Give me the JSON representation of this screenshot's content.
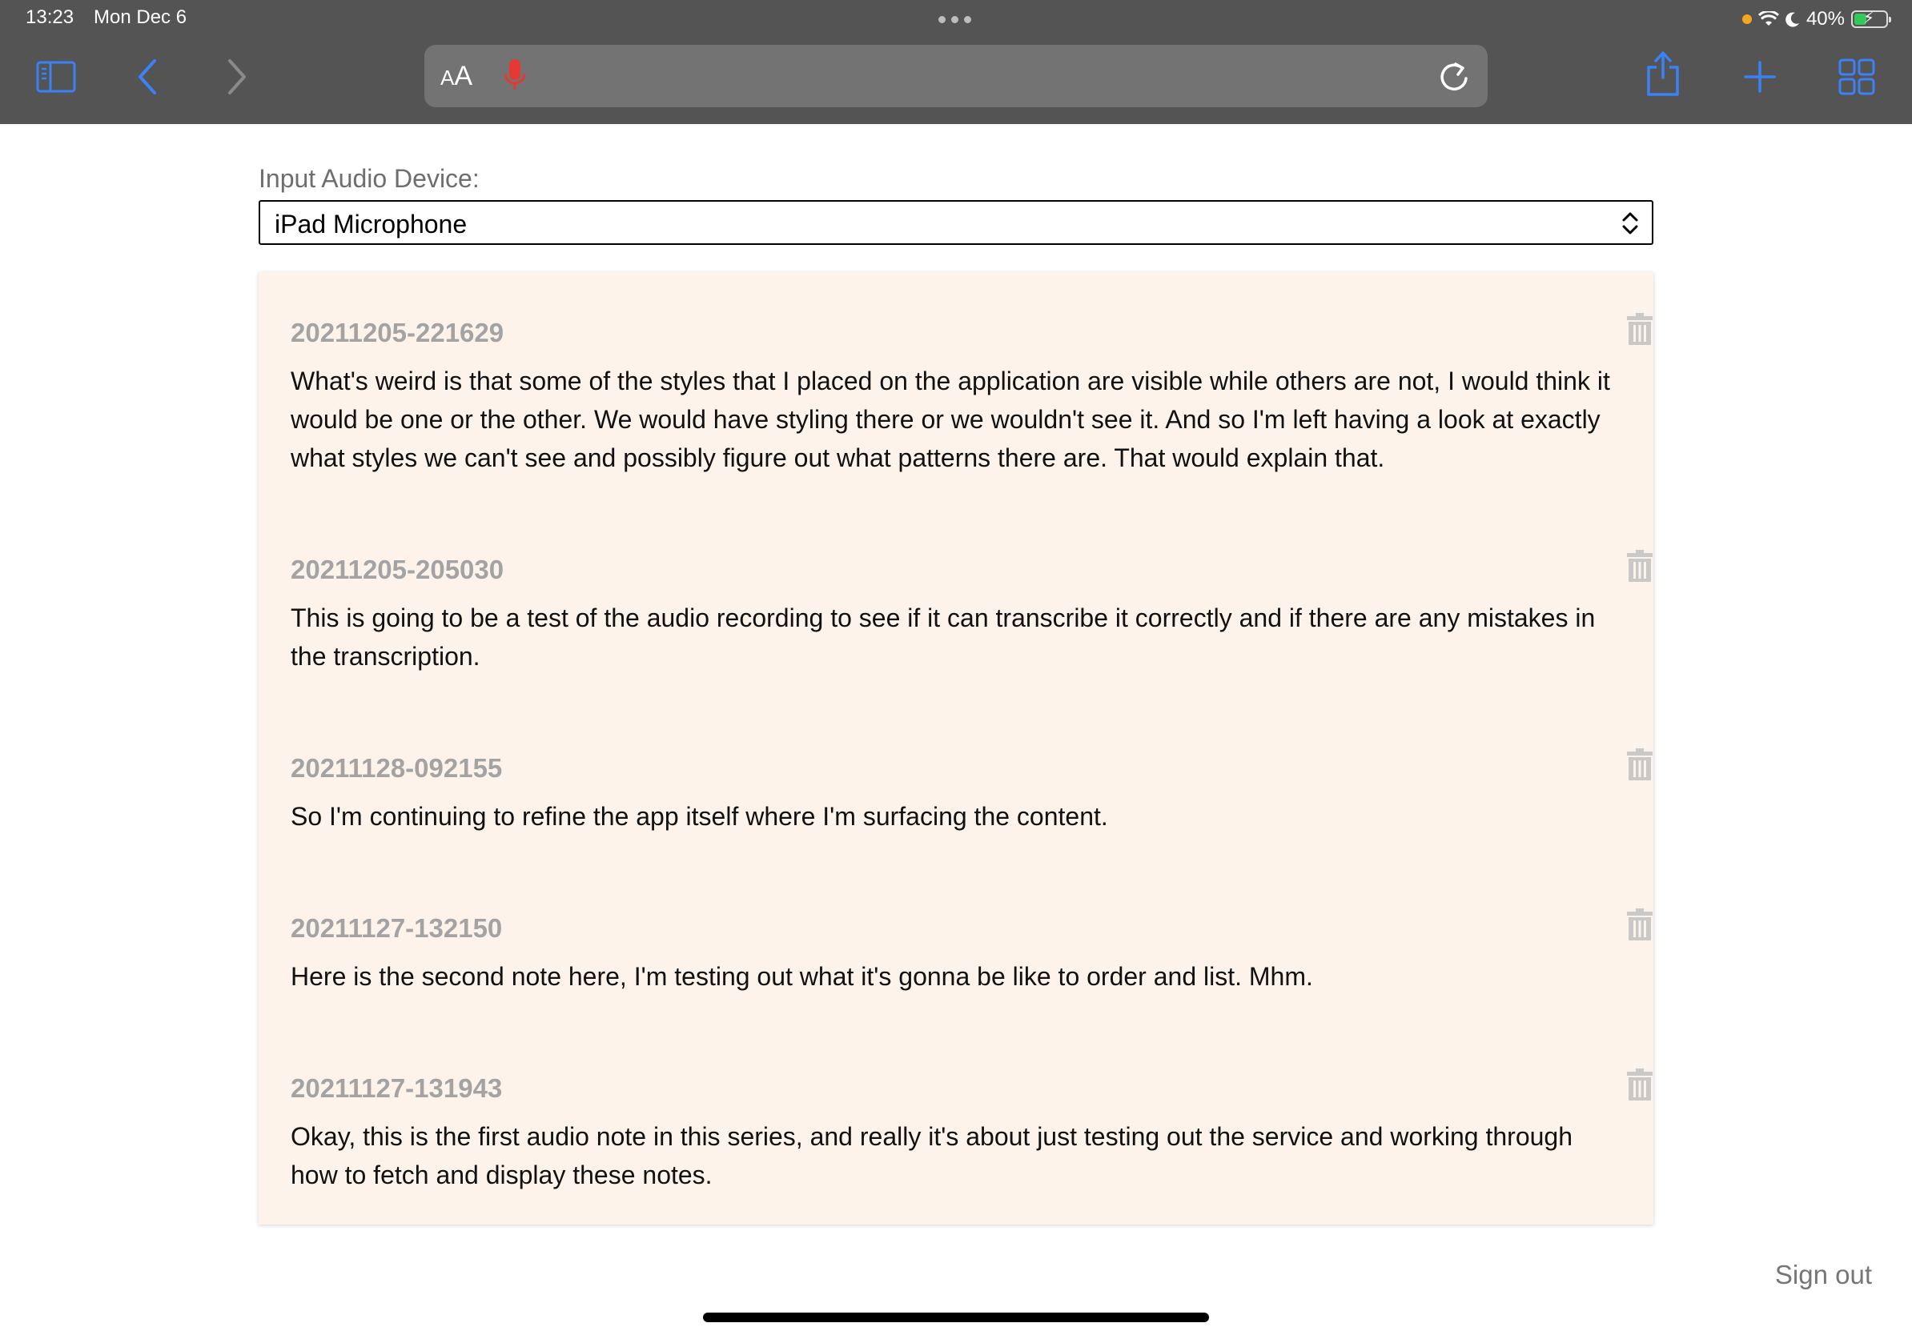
{
  "status_bar": {
    "time": "13:23",
    "date": "Mon Dec 6",
    "battery_text": "40%",
    "battery_level": 0.4
  },
  "browser": {
    "text_size_label_small": "A",
    "text_size_label_large": "A",
    "icons": {
      "sidebar": "sidebar-icon",
      "back": "chevron-left-icon",
      "forward": "chevron-right-icon",
      "mic": "microphone-icon",
      "reload": "reload-icon",
      "share": "share-icon",
      "new_tab": "plus-icon",
      "tabs": "tab-grid-icon"
    },
    "colors": {
      "chrome": "#545454",
      "accent": "#3b82f6",
      "mic": "#e53935"
    }
  },
  "page": {
    "device_label": "Input Audio Device:",
    "device_selected": "iPad Microphone",
    "notes": [
      {
        "id": "20211205-221629",
        "text": "What's weird is that some of the styles that I placed on the application are visible while others are not, I would think it would be one or the other. We would have styling there or we wouldn't see it. And so I'm left having a look at exactly what styles we can't see and possibly figure out what patterns there are. That would explain that."
      },
      {
        "id": "20211205-205030",
        "text": "This is going to be a test of the audio recording to see if it can transcribe it correctly and if there are any mistakes in the transcription."
      },
      {
        "id": "20211128-092155",
        "text": "So I'm continuing to refine the app itself where I'm surfacing the content."
      },
      {
        "id": "20211127-132150",
        "text": "Here is the second note here, I'm testing out what it's gonna be like to order and list. Mhm."
      },
      {
        "id": "20211127-131943",
        "text": "Okay, this is the first audio note in this series, and really it's about just testing out the service and working through how to fetch and display these notes."
      }
    ],
    "sign_out_label": "Sign out",
    "card_color": "#fdf3eb"
  }
}
